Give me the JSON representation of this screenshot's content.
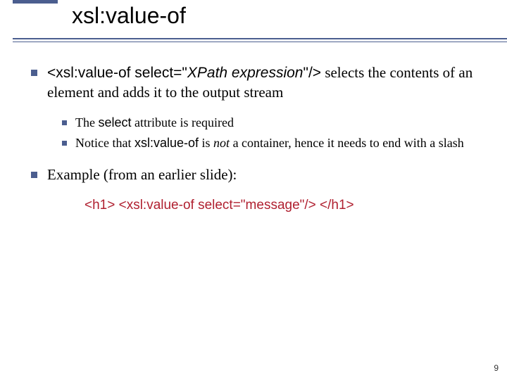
{
  "title": "xsl:value-of",
  "bullets": [
    {
      "parts": [
        {
          "text": "<xsl:value-of  select=\"",
          "cls": "mono"
        },
        {
          "text": "XPath expression",
          "cls": "mono italic"
        },
        {
          "text": "\"/>",
          "cls": "mono"
        },
        {
          "text": " selects the contents of an element and adds it to the output stream",
          "cls": ""
        }
      ],
      "level": 1
    },
    {
      "parts": [
        {
          "text": "The ",
          "cls": ""
        },
        {
          "text": "select",
          "cls": "mono"
        },
        {
          "text": " attribute is required",
          "cls": ""
        }
      ],
      "level": 2
    },
    {
      "parts": [
        {
          "text": "Notice that ",
          "cls": ""
        },
        {
          "text": "xsl:value-of",
          "cls": "mono"
        },
        {
          "text": " is ",
          "cls": ""
        },
        {
          "text": "not",
          "cls": "italic"
        },
        {
          "text": " a container, hence it needs to end with a slash",
          "cls": ""
        }
      ],
      "level": 2
    },
    {
      "parts": [
        {
          "text": "Example (from an earlier slide):",
          "cls": ""
        }
      ],
      "level": 1
    }
  ],
  "example_code": "<h1> <xsl:value-of select=\"message\"/> </h1>",
  "page_number": "9"
}
